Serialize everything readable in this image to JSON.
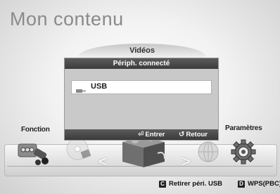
{
  "page": {
    "title": "Mon contenu"
  },
  "carousel": {
    "left_label": "Fonction",
    "right_label": "Paramètres",
    "left_arrow": "<",
    "right_arrow": ">"
  },
  "section": {
    "label": "Vidéos"
  },
  "dialog": {
    "title": "Périph. connecté",
    "device": "USB",
    "enter_label": "Entrer",
    "return_label": "Retour"
  },
  "hints": {
    "c_key": "C",
    "c_label": "Retirer péri. USB",
    "d_key": "D",
    "d_label": "WPS(PBC)"
  },
  "icons": {
    "function": "function-devices-icon",
    "settings": "gear-icon",
    "disc": "disc-icon",
    "globe": "globe-icon",
    "content_box": "content-box-icon",
    "usb": "usb-icon",
    "enter": "enter-icon",
    "return": "return-icon"
  }
}
